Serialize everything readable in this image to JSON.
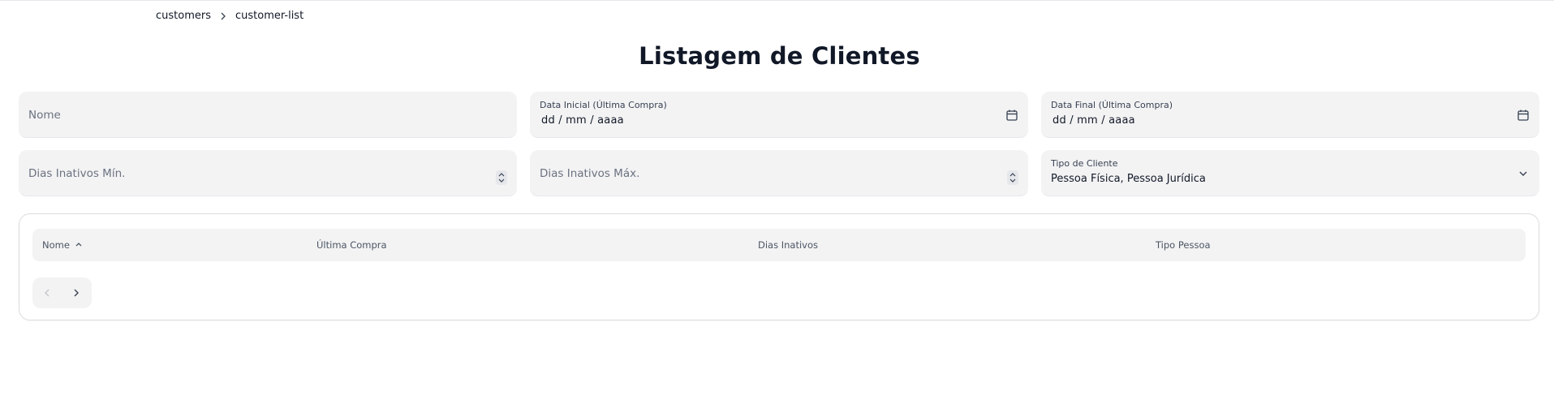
{
  "breadcrumb": {
    "items": [
      "customers",
      "customer-list"
    ]
  },
  "page": {
    "title": "Listagem de Clientes"
  },
  "filters": {
    "nome": {
      "placeholder": "Nome",
      "value": ""
    },
    "data_inicial": {
      "label": "Data Inicial (Última Compra)",
      "value": "dd / mm / aaaa",
      "icon": "calendar-icon"
    },
    "data_final": {
      "label": "Data Final (Última Compra)",
      "value": "dd / mm / aaaa",
      "icon": "calendar-icon"
    },
    "dias_min": {
      "placeholder": "Dias Inativos Mín.",
      "icon": "stepper-icon"
    },
    "dias_max": {
      "placeholder": "Dias Inativos Máx.",
      "icon": "stepper-icon"
    },
    "tipo_cliente": {
      "label": "Tipo de Cliente",
      "value": "Pessoa Física, Pessoa Jurídica",
      "icon": "chevron-down-icon"
    }
  },
  "table": {
    "columns": [
      {
        "label": "Nome",
        "sort": "asc"
      },
      {
        "label": "Última Compra"
      },
      {
        "label": "Dias Inativos"
      },
      {
        "label": "Tipo Pessoa"
      }
    ],
    "rows": []
  },
  "pagination": {
    "prev_icon": "chevron-left-icon",
    "next_icon": "chevron-right-icon",
    "prev_disabled": true
  },
  "colors": {
    "field_bg": "#f3f3f4",
    "text": "#111827",
    "muted": "#6b7280"
  }
}
